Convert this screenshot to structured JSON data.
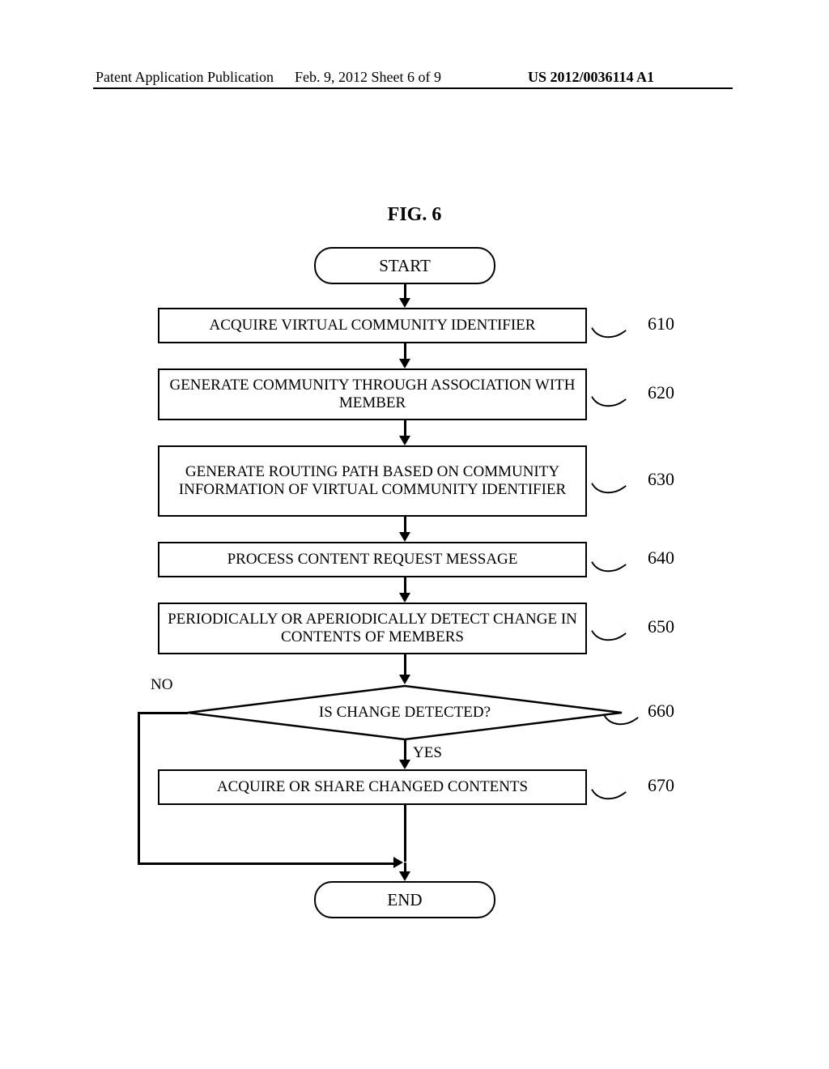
{
  "header": {
    "left": "Patent Application Publication",
    "center": "Feb. 9, 2012  Sheet 6 of 9",
    "right": "US 2012/0036114 A1"
  },
  "figure_title": "FIG. 6",
  "flow": {
    "start": "START",
    "end": "END",
    "step610": "ACQUIRE VIRTUAL COMMUNITY IDENTIFIER",
    "step620": "GENERATE COMMUNITY THROUGH ASSOCIATION WITH MEMBER",
    "step630": "GENERATE ROUTING PATH BASED ON COMMUNITY INFORMATION OF VIRTUAL COMMUNITY IDENTIFIER",
    "step640": "PROCESS CONTENT REQUEST MESSAGE",
    "step650": "PERIODICALLY OR APERIODICALLY DETECT CHANGE IN CONTENTS OF MEMBERS",
    "decision660": "IS CHANGE DETECTED?",
    "step670": "ACQUIRE OR SHARE CHANGED CONTENTS",
    "no_label": "NO",
    "yes_label": "YES"
  },
  "refs": {
    "r610": "610",
    "r620": "620",
    "r630": "630",
    "r640": "640",
    "r650": "650",
    "r660": "660",
    "r670": "670"
  }
}
